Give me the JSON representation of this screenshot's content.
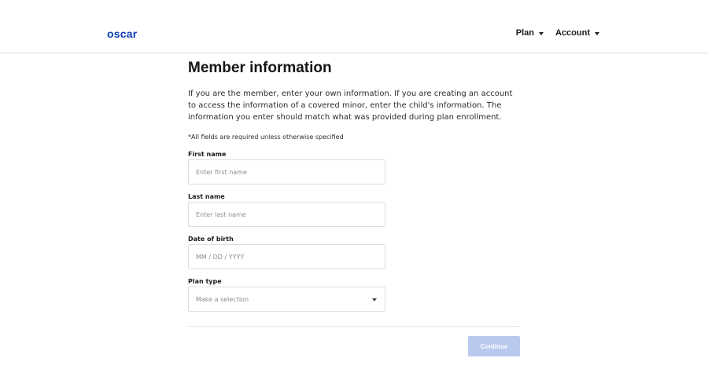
{
  "header": {
    "logo_text": "oscar",
    "nav": [
      {
        "label": "Plan"
      },
      {
        "label": "Account"
      }
    ]
  },
  "main": {
    "title": "Member information",
    "intro": "If you are the member, enter your own information. If you are creating an account to access the information of a covered minor, enter the child's information. The information you enter should match what was provided during plan enrollment.",
    "required_note": "*All fields are required unless otherwise specified",
    "fields": {
      "first_name": {
        "label": "First name",
        "placeholder": "Enter first name",
        "value": ""
      },
      "last_name": {
        "label": "Last name",
        "placeholder": "Enter last name",
        "value": ""
      },
      "dob": {
        "label": "Date of birth",
        "placeholder": "MM / DD / YYYY",
        "value": ""
      },
      "plan_type": {
        "label": "Plan type",
        "selected": "Make a selection"
      }
    },
    "continue_label": "Continue"
  },
  "colors": {
    "brand": "#0a3cb8",
    "button_disabled": "#b9c8ef"
  }
}
